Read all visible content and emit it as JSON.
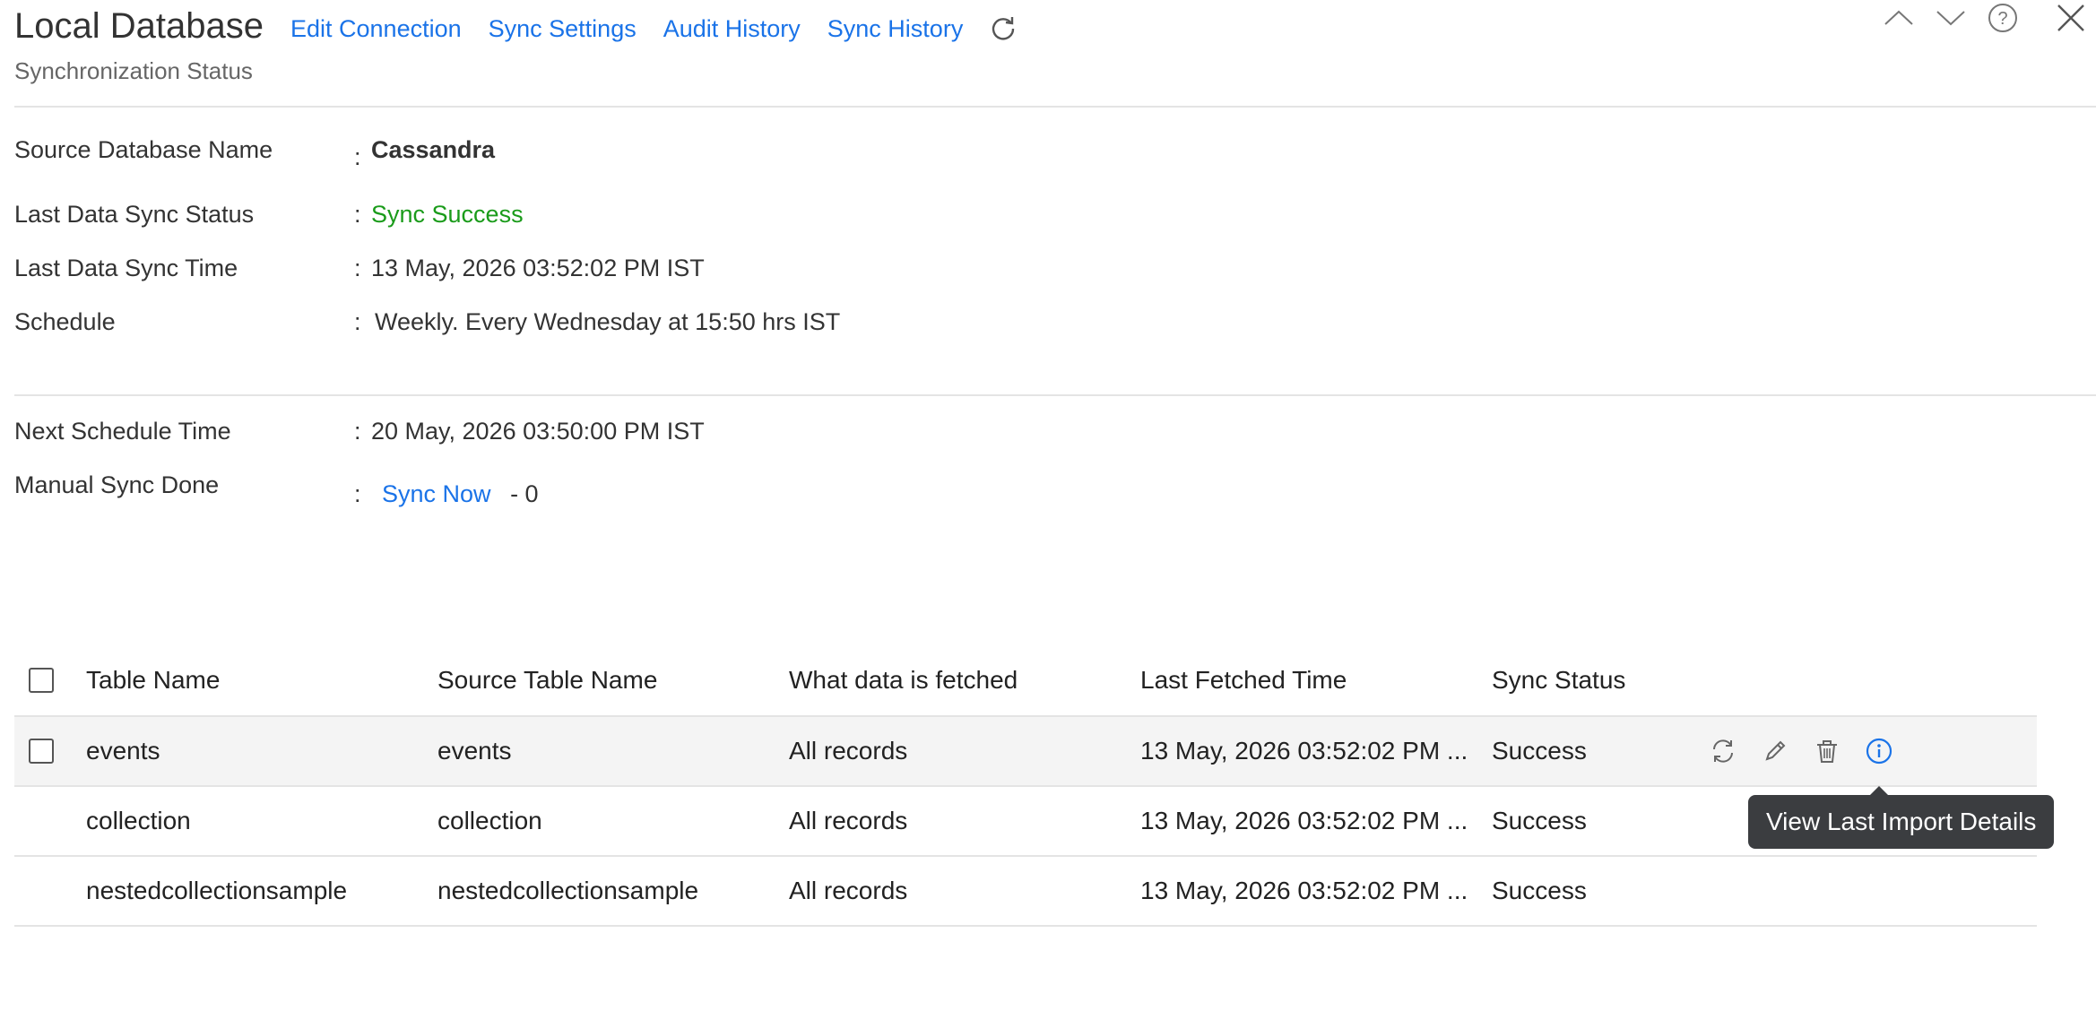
{
  "header": {
    "title": "Local Database",
    "subtitle": "Synchronization Status",
    "nav": [
      "Edit Connection",
      "Sync Settings",
      "Audit History",
      "Sync History"
    ]
  },
  "info": {
    "source_db_label": "Source Database Name",
    "source_db_value": "Cassandra",
    "last_status_label": "Last Data Sync Status",
    "last_status_value": "Sync Success",
    "last_time_label": "Last Data Sync Time",
    "last_time_value": "13 May, 2026 03:52:02 PM IST",
    "schedule_label": "Schedule",
    "schedule_value": "Weekly. Every Wednesday at 15:50 hrs IST",
    "next_label": "Next Schedule Time",
    "next_value": "20 May, 2026 03:50:00 PM IST",
    "manual_label": "Manual Sync Done",
    "sync_now": "Sync Now",
    "manual_count": "- 0",
    "colon": ":"
  },
  "table": {
    "columns": [
      "Table Name",
      "Source Table Name",
      "What data is fetched",
      "Last Fetched Time",
      "Sync Status"
    ],
    "rows": [
      [
        "events",
        "events",
        "All records",
        "13 May, 2026 03:52:02 PM ...",
        "Success"
      ],
      [
        "collection",
        "collection",
        "All records",
        "13 May, 2026 03:52:02 PM ...",
        "Success"
      ],
      [
        "nestedcollectionsample",
        "nestedcollectionsample",
        "All records",
        "13 May, 2026 03:52:02 PM ...",
        "Success"
      ]
    ]
  },
  "tooltip": "View Last Import Details",
  "colors": {
    "link": "#1a73e8",
    "success": "#1a9b1a",
    "tooltip_bg": "#3b3d40"
  },
  "icons": [
    "refresh-icon",
    "chevron-up-icon",
    "chevron-down-icon",
    "help-icon",
    "close-icon",
    "sync-icon",
    "edit-icon",
    "trash-icon",
    "info-icon"
  ]
}
